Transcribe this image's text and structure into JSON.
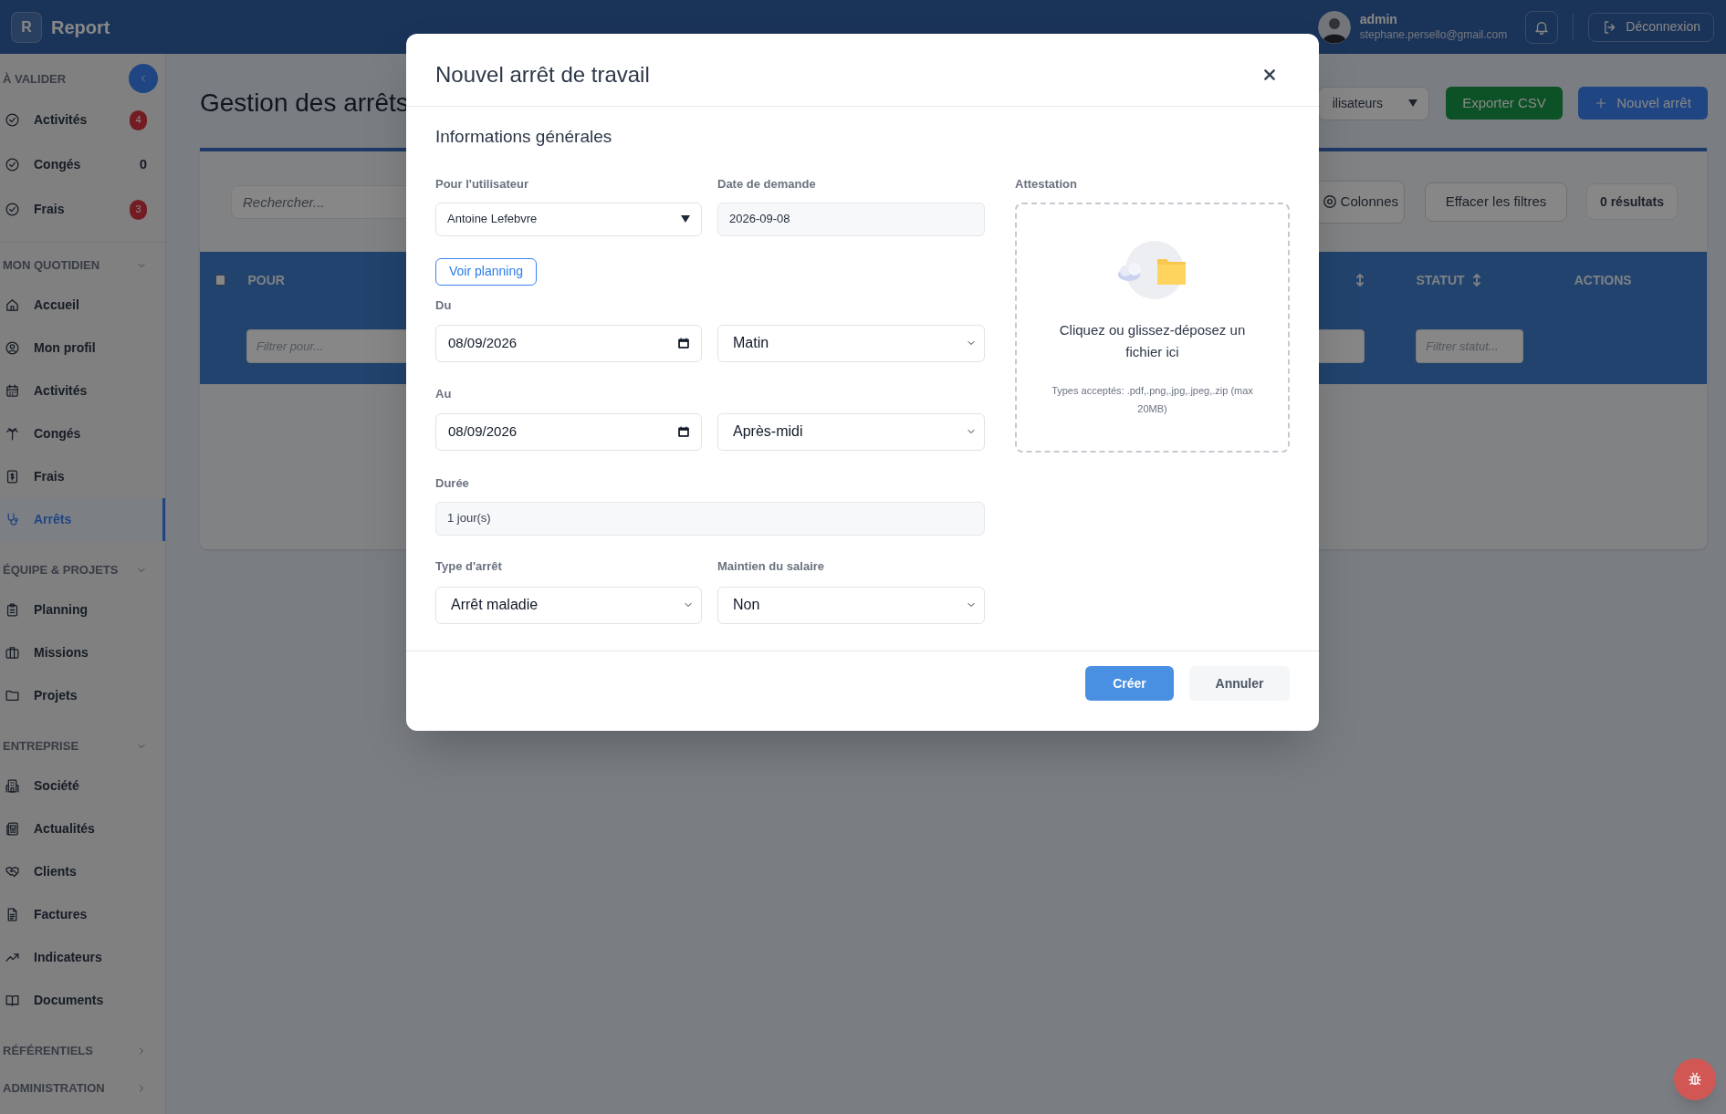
{
  "header": {
    "logo_letter": "R",
    "app_name": "Report",
    "user": {
      "name": "admin",
      "email": "stephane.persello@gmail.com"
    },
    "logout": "Déconnexion"
  },
  "sidebar": {
    "sections": [
      {
        "title": "À VALIDER",
        "items": [
          {
            "label": "Activités",
            "badge": "4",
            "alert": true,
            "selected": false
          },
          {
            "label": "Congés",
            "badge": "0",
            "alert": false,
            "selected": false
          },
          {
            "label": "Frais",
            "badge": "3",
            "alert": true,
            "selected": false
          }
        ]
      },
      {
        "title": "MON QUOTIDIEN",
        "expanded": true,
        "items": [
          {
            "label": "Accueil",
            "selected": false
          },
          {
            "label": "Mon profil",
            "selected": false
          },
          {
            "label": "Activités",
            "selected": false
          },
          {
            "label": "Congés",
            "selected": false
          },
          {
            "label": "Frais",
            "selected": false
          },
          {
            "label": "Arrêts",
            "selected": true
          }
        ]
      },
      {
        "title": "ÉQUIPE & PROJETS",
        "expanded": true,
        "items": [
          {
            "label": "Planning",
            "selected": false
          },
          {
            "label": "Missions",
            "selected": false
          },
          {
            "label": "Projets",
            "selected": false
          }
        ]
      },
      {
        "title": "ENTREPRISE",
        "expanded": true,
        "items": [
          {
            "label": "Société",
            "selected": false
          },
          {
            "label": "Actualités",
            "selected": false
          },
          {
            "label": "Clients",
            "selected": false
          },
          {
            "label": "Factures",
            "selected": false
          },
          {
            "label": "Indicateurs",
            "selected": false
          },
          {
            "label": "Documents",
            "selected": false
          }
        ]
      },
      {
        "title": "RÉFÉRENTIELS",
        "expanded": false
      },
      {
        "title": "ADMINISTRATION",
        "expanded": false
      }
    ]
  },
  "page": {
    "title": "Gestion des arrêts",
    "user_filter": "ilisateurs",
    "export_button": "Exporter CSV",
    "new_button": "Nouvel arrêt",
    "search_placeholder": "Rechercher...",
    "columns_button": "Colonnes",
    "clear_filters_button": "Effacer les filtres",
    "results": "0 résultats",
    "table": {
      "select_all_checked": false,
      "columns": [
        {
          "label": "POUR",
          "filter_placeholder": "Filtrer pour..."
        },
        {
          "sortable": true
        },
        {
          "label": "STATUT",
          "sortable": true,
          "filter_placeholder": "Filtrer statut..."
        },
        {
          "label": "ACTIONS"
        }
      ]
    }
  },
  "modal": {
    "title": "Nouvel arrêt de travail",
    "section_title": "Informations générales",
    "user_field": {
      "label": "Pour l'utilisateur",
      "value": "Antoine Lefebvre"
    },
    "request_date": {
      "label": "Date de demande",
      "value": "2026-09-08"
    },
    "planning_button": "Voir planning",
    "from": {
      "label": "Du",
      "date": "08/09/2026",
      "period": "Matin"
    },
    "to": {
      "label": "Au",
      "date": "08/09/2026",
      "period": "Après-midi"
    },
    "duration": {
      "label": "Durée",
      "value": "1 jour(s)"
    },
    "leave_type": {
      "label": "Type d'arrêt",
      "value": "Arrêt maladie"
    },
    "salary": {
      "label": "Maintien du salaire",
      "value": "Non"
    },
    "attachment": {
      "label": "Attestation",
      "prompt": "Cliquez ou glissez-déposez un fichier ici",
      "hint": "Types acceptés: .pdf,.png,.jpg,.jpeg,.zip (max 20MB)"
    },
    "create_button": "Créer",
    "cancel_button": "Annuler"
  }
}
